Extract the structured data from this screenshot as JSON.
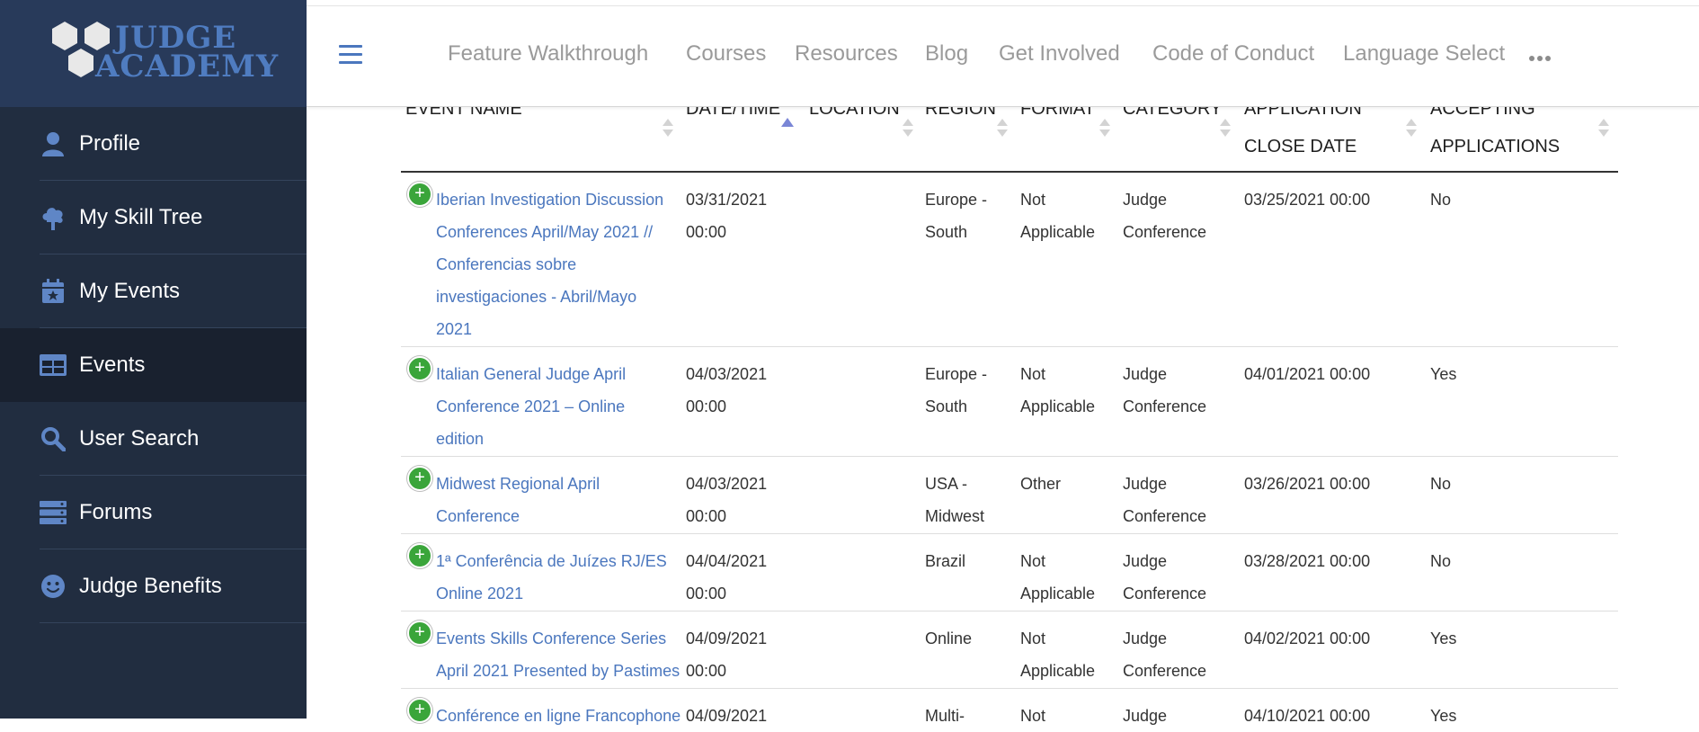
{
  "logo": {
    "line1": "JUDGE",
    "line2": "ACADEMY",
    "color": "#4f7cc0"
  },
  "sidebar": {
    "background": "#212d40",
    "items": [
      {
        "label": "Profile",
        "icon": "user-icon",
        "active": false
      },
      {
        "label": "My Skill Tree",
        "icon": "tree-icon",
        "active": false
      },
      {
        "label": "My Events",
        "icon": "calendar-star-icon",
        "active": false
      },
      {
        "label": "Events",
        "icon": "table-icon",
        "active": true
      },
      {
        "label": "User Search",
        "icon": "search-icon",
        "active": false
      },
      {
        "label": "Forums",
        "icon": "server-icon",
        "active": false
      },
      {
        "label": "Judge Benefits",
        "icon": "smile-icon",
        "active": false
      }
    ]
  },
  "topnav": {
    "menu_icon": "hamburger-icon",
    "links": [
      "Feature Walkthrough",
      "Courses",
      "Resources",
      "Blog",
      "Get Involved",
      "Code of Conduct",
      "Language Select"
    ],
    "more_icon": "ellipsis-icon"
  },
  "table": {
    "columns": [
      {
        "line1": "EVENT NAME",
        "line2": ""
      },
      {
        "line1": "DATE/TIME",
        "line2": ""
      },
      {
        "line1": "LOCATION",
        "line2": ""
      },
      {
        "line1": "REGION",
        "line2": ""
      },
      {
        "line1": "FORMAT",
        "line2": ""
      },
      {
        "line1": "CATEGORY",
        "line2": ""
      },
      {
        "line1": "APPLICATION",
        "line2": "CLOSE DATE"
      },
      {
        "line1": "ACCEPTING",
        "line2": "APPLICATIONS"
      }
    ],
    "sorted_column": "DATE/TIME",
    "sort_direction": "ascending",
    "link_color": "#4b77be",
    "rows": [
      {
        "name": [
          "Iberian Investigation Discussion",
          "Conferences April/May 2021 //",
          "Conferencias sobre",
          "investigaciones - Abril/Mayo",
          "2021"
        ],
        "date": [
          "03/31/2021",
          "00:00"
        ],
        "location": [],
        "region": [
          "Europe -",
          "South"
        ],
        "format": [
          "Not",
          "Applicable"
        ],
        "category": [
          "Judge",
          "Conference"
        ],
        "close_date": "03/25/2021 00:00",
        "accepting": "No"
      },
      {
        "name": [
          "Italian General Judge April",
          "Conference 2021 – Online",
          "edition"
        ],
        "date": [
          "04/03/2021",
          "00:00"
        ],
        "location": [],
        "region": [
          "Europe -",
          "South"
        ],
        "format": [
          "Not",
          "Applicable"
        ],
        "category": [
          "Judge",
          "Conference"
        ],
        "close_date": "04/01/2021 00:00",
        "accepting": "Yes"
      },
      {
        "name": [
          "Midwest Regional April",
          "Conference"
        ],
        "date": [
          "04/03/2021",
          "00:00"
        ],
        "location": [],
        "region": [
          "USA -",
          "Midwest"
        ],
        "format": [
          "Other"
        ],
        "category": [
          "Judge",
          "Conference"
        ],
        "close_date": "03/26/2021 00:00",
        "accepting": "No"
      },
      {
        "name": [
          "1ª Conferência de Juízes RJ/ES",
          "Online 2021"
        ],
        "date": [
          "04/04/2021",
          "00:00"
        ],
        "location": [],
        "region": [
          "Brazil"
        ],
        "format": [
          "Not",
          "Applicable"
        ],
        "category": [
          "Judge",
          "Conference"
        ],
        "close_date": "03/28/2021 00:00",
        "accepting": "No"
      },
      {
        "name": [
          "Events Skills Conference Series",
          "April 2021 Presented by Pastimes"
        ],
        "date": [
          "04/09/2021",
          "00:00"
        ],
        "location": [],
        "region": [
          "Online"
        ],
        "format": [
          "Not",
          "Applicable"
        ],
        "category": [
          "Judge",
          "Conference"
        ],
        "close_date": "04/02/2021 00:00",
        "accepting": "Yes"
      },
      {
        "name": [
          "Conférence en ligne Francophone"
        ],
        "date": [
          "04/09/2021"
        ],
        "location": [],
        "region": [
          "Multi-"
        ],
        "format": [
          "Not"
        ],
        "category": [
          "Judge"
        ],
        "close_date": "04/10/2021 00:00",
        "accepting": "Yes"
      }
    ]
  }
}
